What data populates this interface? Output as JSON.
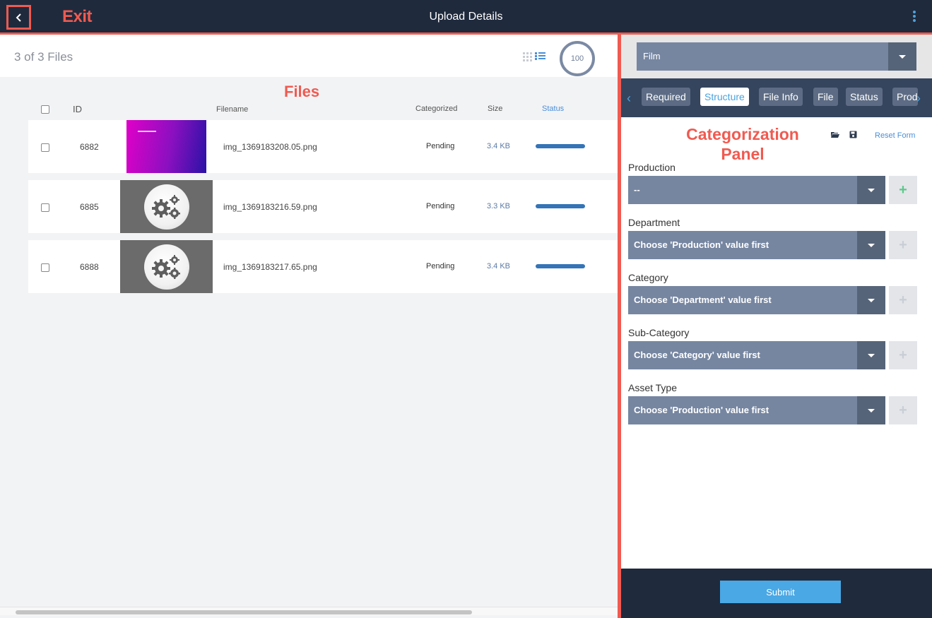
{
  "header": {
    "title": "Upload Details",
    "exit_annotation": "Exit"
  },
  "files_pane": {
    "count_text": "3 of 3 Files",
    "progress_value": "100",
    "annotation": "Files",
    "columns": {
      "id": "ID",
      "filename": "Filename",
      "categorized": "Categorized",
      "size": "Size",
      "status": "Status"
    },
    "rows": [
      {
        "id": "6882",
        "filename": "img_1369183208.05.png",
        "categorized": "Pending",
        "size": "3.4 KB",
        "thumbnail": "gradient-image",
        "progress": 1.0
      },
      {
        "id": "6885",
        "filename": "img_1369183216.59.png",
        "categorized": "Pending",
        "size": "3.3 KB",
        "thumbnail": "gears-icon",
        "progress": 1.0
      },
      {
        "id": "6888",
        "filename": "img_1369183217.65.png",
        "categorized": "Pending",
        "size": "3.4 KB",
        "thumbnail": "gears-icon",
        "progress": 1.0
      }
    ]
  },
  "panel": {
    "film_select": "Film",
    "tabs": [
      "Required",
      "Structure",
      "File Info",
      "File",
      "Status",
      "Prod"
    ],
    "active_tab": "Structure",
    "annotation_line1": "Categorization",
    "annotation_line2": "Panel",
    "reset_label": "Reset Form",
    "fields": [
      {
        "label": "Production",
        "value": "--",
        "add_enabled": true
      },
      {
        "label": "Department",
        "value": "Choose 'Production' value first",
        "add_enabled": false
      },
      {
        "label": "Category",
        "value": "Choose 'Department' value first",
        "add_enabled": false
      },
      {
        "label": "Sub-Category",
        "value": "Choose 'Category' value first",
        "add_enabled": false
      },
      {
        "label": "Asset Type",
        "value": "Choose 'Production' value first",
        "add_enabled": false
      }
    ],
    "add_symbol": "+",
    "submit_label": "Submit"
  },
  "colors": {
    "annotation_red": "#f05a50",
    "topbar_bg": "#1f2a3d",
    "select_bg": "#7686a1",
    "accent_blue": "#4aa3df",
    "status_bar": "#3474b7"
  }
}
